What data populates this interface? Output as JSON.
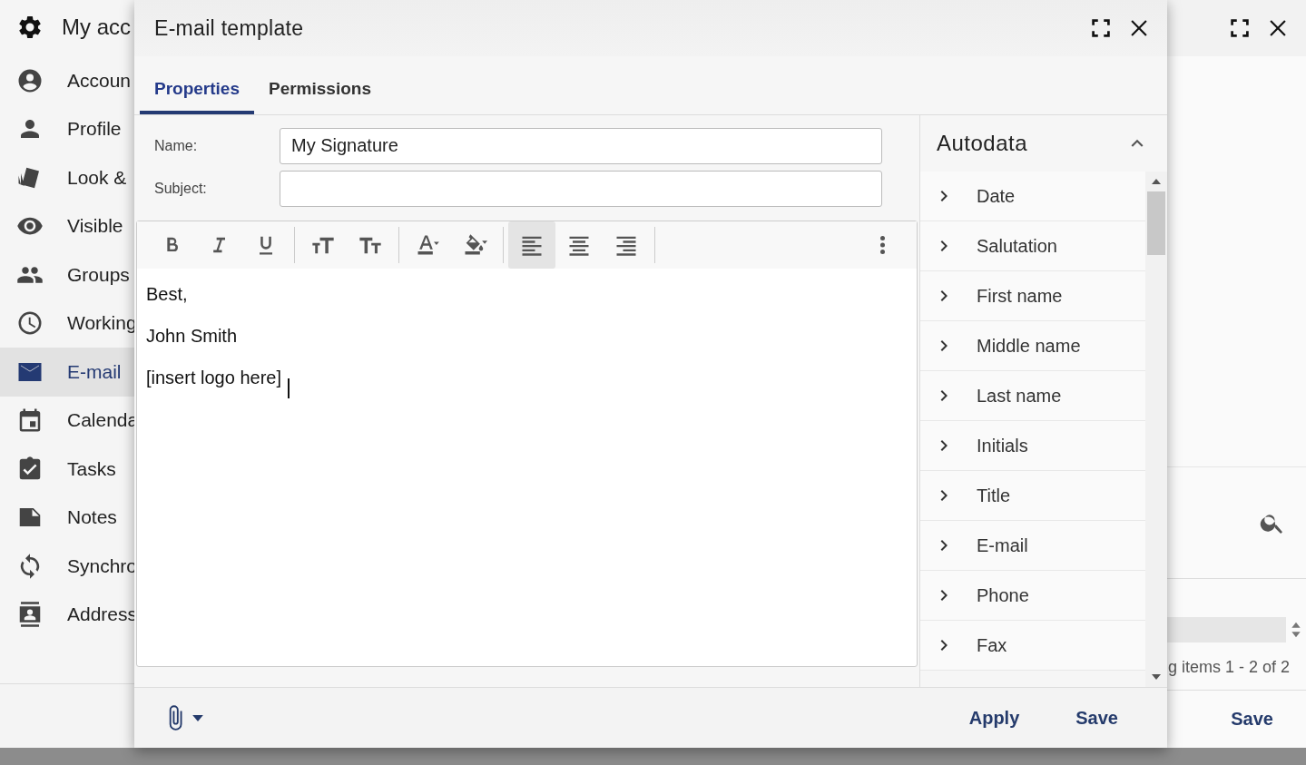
{
  "app": {
    "title": "My acc",
    "sidebar": [
      {
        "label": "Accoun",
        "selected": false
      },
      {
        "label": "Profile",
        "selected": false
      },
      {
        "label": "Look &",
        "selected": false
      },
      {
        "label": "Visible",
        "selected": false
      },
      {
        "label": "Groups",
        "selected": false
      },
      {
        "label": "Working",
        "selected": false
      },
      {
        "label": "E-mail",
        "selected": true
      },
      {
        "label": "Calenda",
        "selected": false
      },
      {
        "label": "Tasks",
        "selected": false
      },
      {
        "label": "Notes",
        "selected": false
      },
      {
        "label": "Synchro",
        "selected": false
      },
      {
        "label": "Address",
        "selected": false
      }
    ],
    "panel": {
      "pager": "g items 1 - 2 of 2",
      "save": "Save"
    }
  },
  "dialog": {
    "title": "E-mail template",
    "tabs": [
      {
        "label": "Properties",
        "selected": true
      },
      {
        "label": "Permissions",
        "selected": false
      }
    ],
    "fields": [
      {
        "label": "Name:",
        "value": "My Signature"
      },
      {
        "label": "Subject:"
      }
    ],
    "toolbar": [
      {
        "selected": false
      },
      {
        "selected": false
      },
      {
        "selected": false
      },
      {
        "selected": false
      },
      {
        "selected": false
      },
      {
        "selected": false
      },
      {
        "selected": false
      },
      {
        "selected": true
      },
      {
        "selected": false
      },
      {
        "selected": false
      },
      {
        "selected": false
      }
    ],
    "editor": {
      "lines": [
        "Best,",
        "John Smith",
        "[insert logo here]"
      ]
    },
    "autodata": {
      "title": "Autodata",
      "expanded": true,
      "items": [
        "Date",
        "Salutation",
        "First name",
        "Middle name",
        "Last name",
        "Initials",
        "Title",
        "E-mail",
        "Phone",
        "Fax"
      ]
    },
    "buttons": [
      "Apply",
      "Save"
    ]
  }
}
